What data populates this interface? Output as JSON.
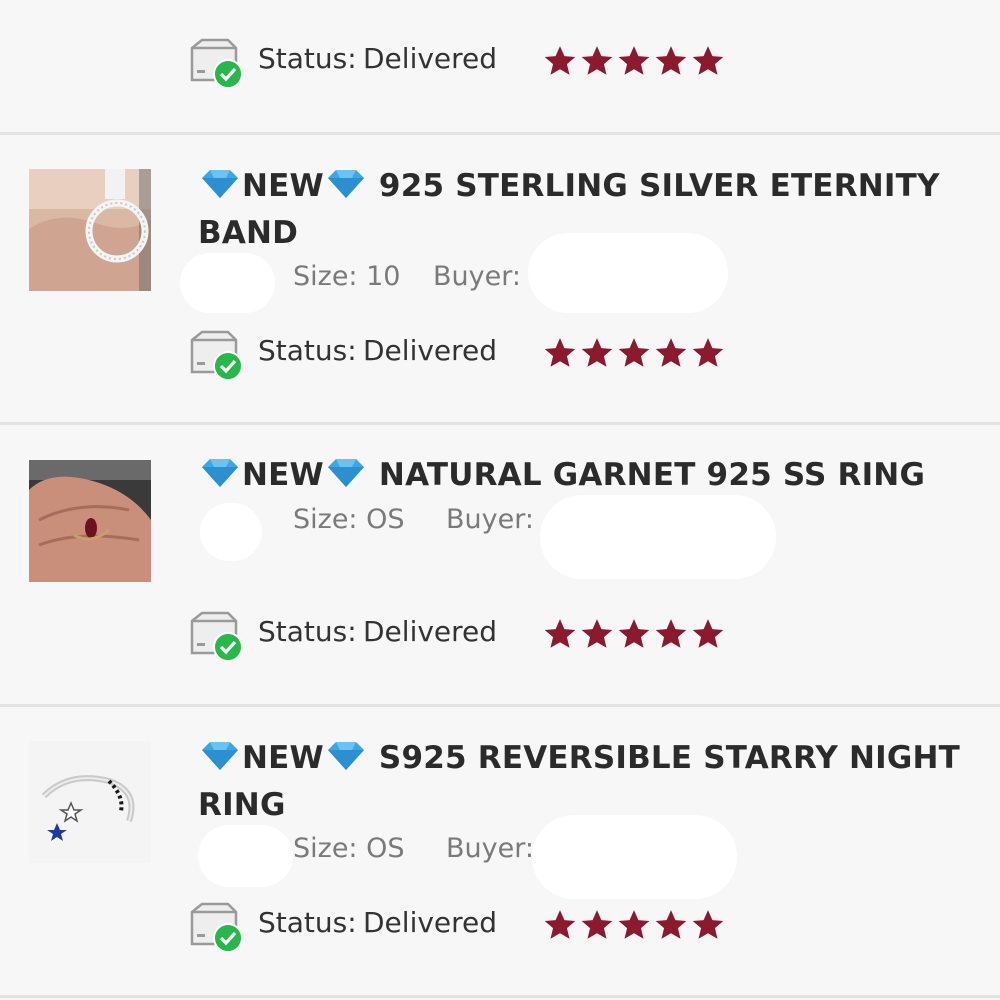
{
  "colors": {
    "star": "#8b1a2f",
    "check": "#27b84a",
    "divider": "#e3e3e3",
    "background": "#f7f7f7"
  },
  "status_label": "Status:",
  "orders": [
    {
      "title_parts": [
        "",
        "",
        "",
        ""
      ],
      "size": "",
      "buyer": "",
      "status": "Delivered",
      "rating": 5
    },
    {
      "title_prefix": "NEW",
      "title": "925 STERLING SILVER ETERNITY BAND",
      "size": "Size: 10",
      "buyer": "Buyer:",
      "status": "Delivered",
      "rating": 5,
      "image": "silver-eternity-band-photo"
    },
    {
      "title_prefix": "NEW",
      "title": "NATURAL GARNET 925 SS RING",
      "size": "Size: OS",
      "buyer": "Buyer:",
      "status": "Delivered",
      "rating": 5,
      "image": "garnet-ring-on-hand-photo"
    },
    {
      "title_prefix": "NEW",
      "title": "S925 REVERSIBLE STARRY NIGHT RING",
      "size": "Size: OS",
      "buyer": "Buyer:",
      "status": "Delivered",
      "rating": 5,
      "image": "starry-night-ring-photo"
    }
  ],
  "icons": {
    "gem": "gem-emoji-icon",
    "delivered": "delivered-box-icon",
    "star": "star-icon"
  }
}
